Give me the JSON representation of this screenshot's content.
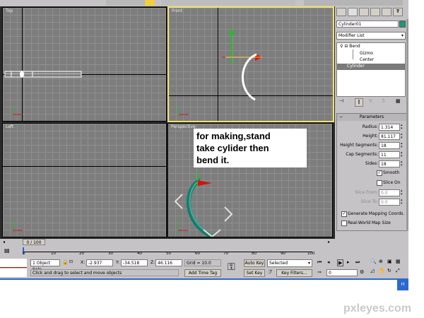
{
  "viewports": {
    "top": "Top",
    "front": "Front",
    "left": "Left",
    "perspective": "Perspective"
  },
  "annotation": [
    "for making,stand",
    "take cylider then",
    "bend it."
  ],
  "command_panel": {
    "object_name": "Cylinder01",
    "modifier_list": "Modifier List",
    "stack": {
      "bend": "Bend",
      "gizmo": "Gizmo",
      "center": "Center",
      "cylinder": "Cylinder"
    }
  },
  "parameters": {
    "title": "Parameters",
    "radius_label": "Radius:",
    "radius": "1.314",
    "height_label": "Height:",
    "height": "81.117",
    "height_segments_label": "Height Segments:",
    "height_segments": "18",
    "cap_segments_label": "Cap Segments:",
    "cap_segments": "11",
    "sides_label": "Sides:",
    "sides": "18",
    "smooth_label": "Smooth",
    "smooth_checked": true,
    "slice_on_label": "Slice On",
    "slice_on_checked": false,
    "slice_from_label": "Slice From:",
    "slice_from": "0.0",
    "slice_to_label": "Slice To:",
    "slice_to": "0.0",
    "gen_mapping_label": "Generate Mapping Coords.",
    "gen_mapping_checked": true,
    "real_world_label": "Real-World Map Size",
    "real_world_checked": false
  },
  "timeline": {
    "frame": "0 / 100",
    "ticks": [
      "0",
      "10",
      "20",
      "30",
      "40",
      "50",
      "60",
      "70",
      "80",
      "90",
      "100"
    ]
  },
  "status": {
    "selection": "1 Object Sele",
    "x_label": "X:",
    "x": "-2.937",
    "y_label": "Y:",
    "y": "-34.518",
    "z_label": "Z:",
    "z": "46.116",
    "grid": "Grid = 10.0",
    "prompt": "Click and drag to select and move objects",
    "add_time_tag": "Add Time Tag",
    "auto_key": "Auto Key",
    "set_key": "Set Key",
    "key_mode": "Selected",
    "key_filters": "Key Filters...",
    "current_frame": "0"
  },
  "watermark": "pxleyes.com",
  "colors": {
    "active_border": "#f0e26a",
    "viewport_bg": "#7d7d7d",
    "object": "#1a7a6a",
    "gizmo_red": "#d81010",
    "gizmo_green": "#20c020"
  }
}
